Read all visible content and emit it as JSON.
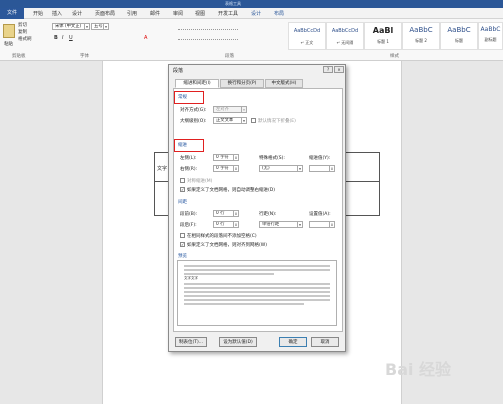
{
  "titlebar": {
    "doc_title": "表格工具"
  },
  "tabs": [
    "文件",
    "开始",
    "插入",
    "设计",
    "页面布局",
    "引用",
    "邮件",
    "审阅",
    "视图",
    "开发工具",
    "设计",
    "布局"
  ],
  "clipboard": {
    "paste": "粘贴",
    "cut": "剪切",
    "copy": "复制",
    "painter": "格式刷",
    "group": "剪贴板"
  },
  "font": {
    "name": "宋体 (中文正)",
    "size": "五号",
    "group": "字体"
  },
  "paragraph": {
    "group": "段落"
  },
  "styles": {
    "group": "样式",
    "items": [
      {
        "preview": "AaBbCcDd",
        "name": "↵ 正文"
      },
      {
        "preview": "AaBbCcDd",
        "name": "↵ 无间隔"
      },
      {
        "preview": "AaBl",
        "name": "标题 1"
      },
      {
        "preview": "AaBbC",
        "name": "标题 2"
      },
      {
        "preview": "AaBbC",
        "name": "标题"
      },
      {
        "preview": "AaBbC",
        "name": "副标题"
      }
    ]
  },
  "doc": {
    "cell_text": "文字"
  },
  "dialog": {
    "title": "段落",
    "help": "?",
    "close": "×",
    "tabs": [
      "缩进和间距(I)",
      "换行和分页(P)",
      "中文版式(H)"
    ],
    "general": {
      "label": "常规",
      "align_label": "对齐方式(G):",
      "align_value": "左对齐",
      "outline_label": "大纲级别(O):",
      "outline_value": "正文文本",
      "collapse_label": "默认情况下折叠(E)"
    },
    "indent": {
      "label": "缩进",
      "left_label": "左侧(L):",
      "left_value": "0 字符",
      "right_label": "右侧(R):",
      "right_value": "0 字符",
      "special_label": "特殊格式(S):",
      "special_value": "(无)",
      "by_label": "缩进值(Y):",
      "mirror_label": "对称缩进(M)",
      "grid_label": "如果定义了文档网格，则自动调整右缩进(D)"
    },
    "spacing": {
      "label": "间距",
      "before_label": "段前(B):",
      "before_value": "0 行",
      "after_label": "段后(F):",
      "after_value": "0 行",
      "line_label": "行距(N):",
      "line_value": "单倍行距",
      "at_label": "设置值(A):",
      "no_space_label": "在相同样式的段落间不添加空格(C)",
      "snap_label": "如果定义了文档网格，则对齐到网格(W)"
    },
    "preview": {
      "label": "预览",
      "sample": "文字文字"
    },
    "buttons": {
      "tabs": "制表位(T)...",
      "default": "设为默认值(D)",
      "ok": "确定",
      "cancel": "取消"
    }
  },
  "watermark": "Bai 经验"
}
